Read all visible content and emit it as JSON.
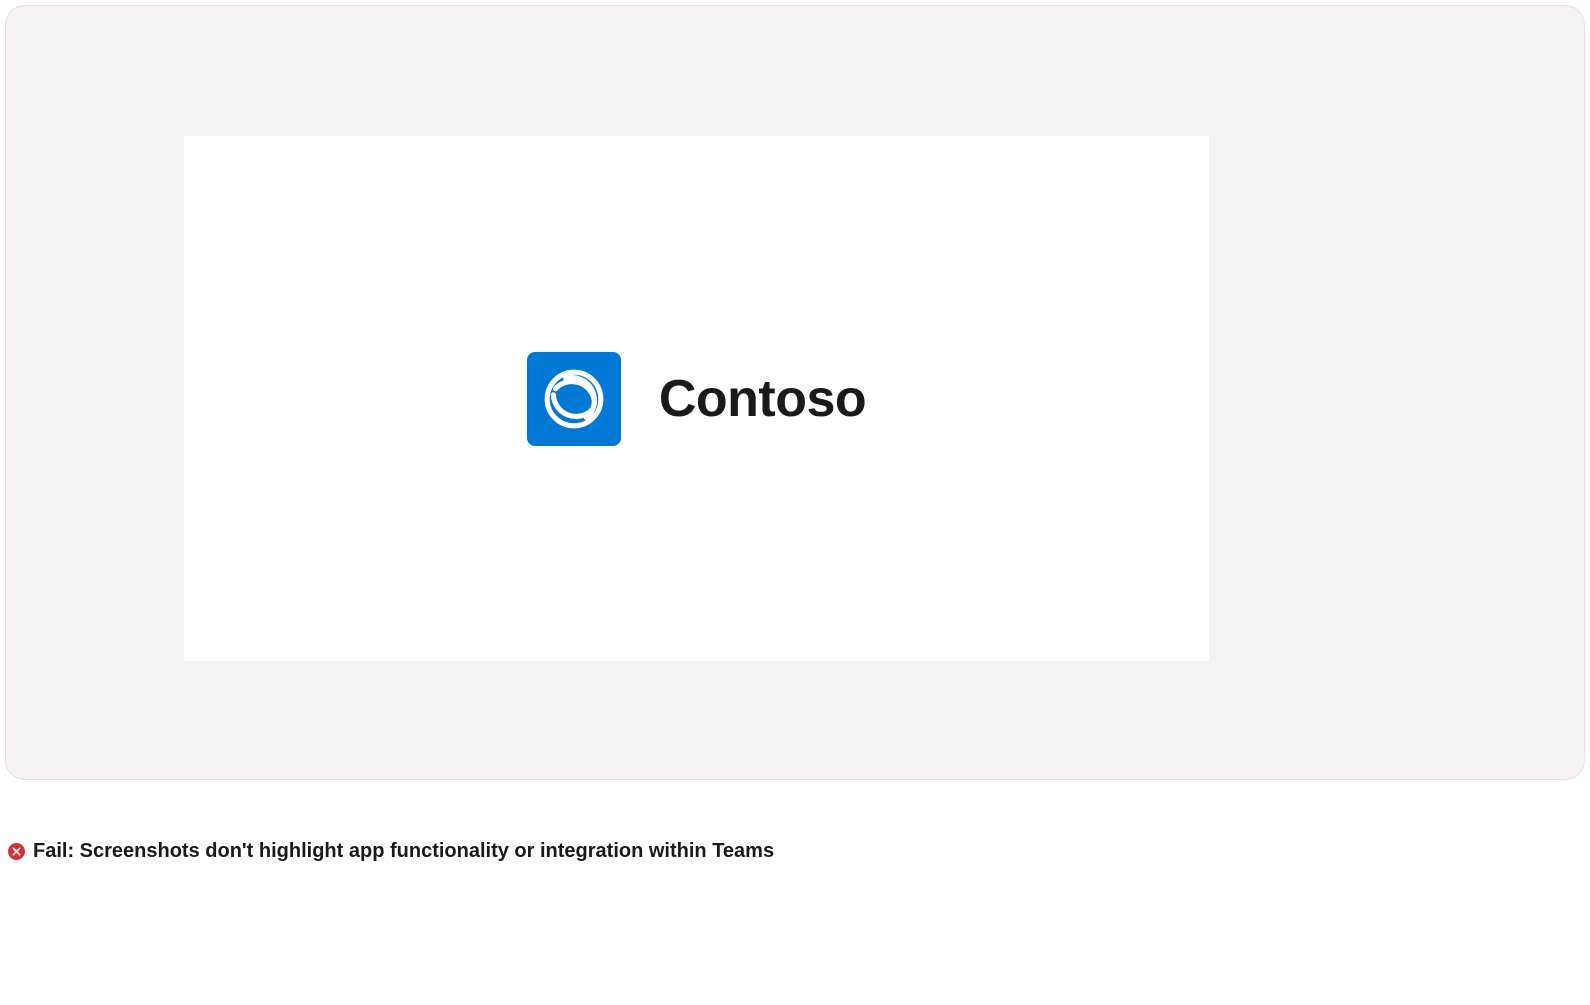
{
  "brand": {
    "name": "Contoso",
    "logo_color": "#0078d4"
  },
  "caption": {
    "status": "Fail",
    "text": "Fail: Screenshots don't highlight app functionality or integration within Teams",
    "icon_color": "#d13438"
  }
}
